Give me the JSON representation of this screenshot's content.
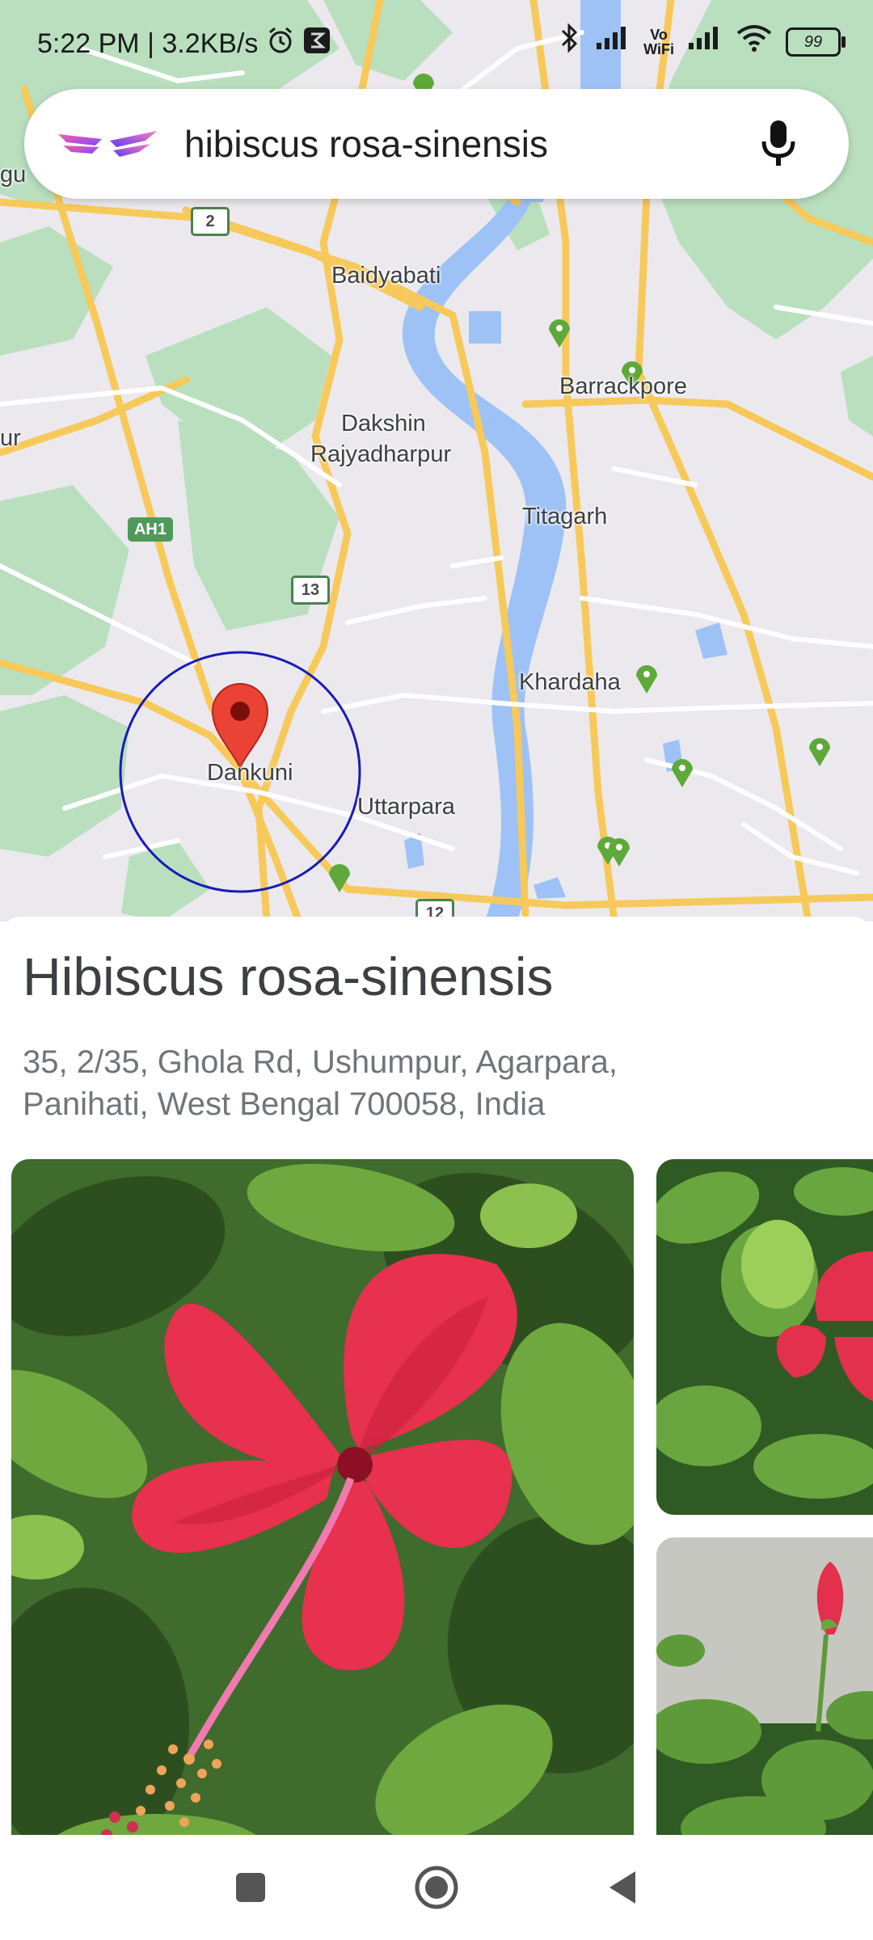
{
  "status_bar": {
    "time_speed": "5:22 PM | 3.2KB/s",
    "vowifi_top": "Vo",
    "vowifi_bottom": "WiFi",
    "battery": "99",
    "icons": [
      "alarm-icon",
      "app-notification-icon",
      "bluetooth-icon",
      "signal-icon",
      "vowifi-icon",
      "signal-icon-2",
      "wifi-icon",
      "battery-icon"
    ]
  },
  "search": {
    "query": "hibiscus rosa-sinensis",
    "logo_icon": "app-logo-icon",
    "mic_icon": "microphone-icon"
  },
  "map": {
    "labels": {
      "baidyabati": "Baidyabati",
      "barrackpore": "Barrackpore",
      "dakshin": "Dakshin",
      "rajyadharpur": "Rajyadharpur",
      "titagarh": "Titagarh",
      "khardaha": "Khardaha",
      "dankuni": "Dankuni",
      "uttarpara": "Uttarpara",
      "edge_left_top": "gu",
      "edge_left_mid": "ur"
    },
    "shields": {
      "nh2": "2",
      "ah1": "AH1",
      "nh13": "13",
      "nh12": "12"
    },
    "colors": {
      "land": "#ece9ee",
      "park": "#b9dfbf",
      "water": "#9ec2f5",
      "road": "#f6c95a",
      "pin": "#ea4335",
      "radius_circle": "#1a1ab8",
      "green_marker": "#5fa83a"
    },
    "icons": [
      "location-pin-icon",
      "green-marker-icon"
    ]
  },
  "place": {
    "title": "Hibiscus rosa-sinensis",
    "address_line1": "35, 2/35, Ghola Rd, Ushumpur, Agarpara,",
    "address_line2": "Panihati, West Bengal 700058, India"
  },
  "photos": [
    "hibiscus-flower-photo",
    "hibiscus-plant-photo",
    "hibiscus-bud-photo"
  ],
  "nav_bar": {
    "icons": [
      "recents-square-icon",
      "home-circle-icon",
      "back-triangle-icon"
    ]
  }
}
